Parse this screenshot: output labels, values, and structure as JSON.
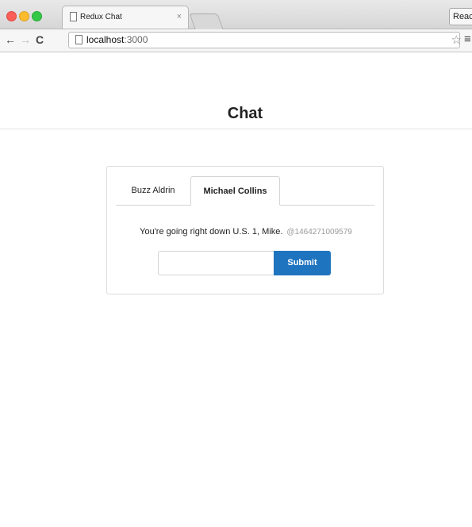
{
  "browser": {
    "tab_title": "Redux Chat",
    "tab_close": "×",
    "extension_button": "React",
    "url_host": "localhost",
    "url_port": ":3000",
    "icons": [
      "back-icon",
      "forward-icon",
      "reload-icon",
      "page-icon",
      "star-icon",
      "menu-icon"
    ]
  },
  "page": {
    "title": "Chat",
    "tabs": [
      "Buzz Aldrin",
      "Michael Collins"
    ],
    "active_tab": "Michael Collins",
    "message": {
      "text": "You're going right down U.S. 1, Mike.",
      "timestamp": "@1464271009579"
    },
    "input_value": "",
    "submit_label": "Submit"
  },
  "colors": {
    "accent": "#1f74bf"
  }
}
